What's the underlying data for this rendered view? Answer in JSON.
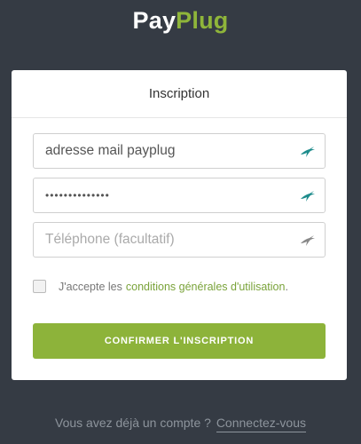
{
  "logo": {
    "pay": "Pay",
    "plug": "Plug"
  },
  "card": {
    "title": "Inscription",
    "email": {
      "value": "adresse mail payplug"
    },
    "password": {
      "value": "••••••••••••••"
    },
    "phone": {
      "placeholder": "Téléphone (facultatif)"
    },
    "terms": {
      "prefix": "J'accepte les",
      "link": "conditions générales d'utilisation",
      "suffix": "."
    },
    "confirm_label": "CONFIRMER L'INSCRIPTION"
  },
  "footer": {
    "text": "Vous avez déjà un compte ?",
    "link": "Connectez-vous"
  },
  "colors": {
    "brand_green": "#8db33a",
    "background": "#353b44",
    "icon_teal": "#1e8c8c"
  },
  "icons": [
    "auth-bird-icon"
  ]
}
